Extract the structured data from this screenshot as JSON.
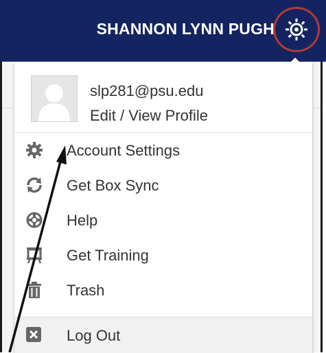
{
  "header": {
    "user_name": "SHANNON LYNN PUGH",
    "bg_color": "#142460",
    "gear_icon": "gear-icon"
  },
  "profile": {
    "email": "slp281@psu.edu",
    "edit_label": "Edit / View Profile",
    "avatar_icon": "person-silhouette-icon"
  },
  "menu": {
    "items": [
      {
        "label": "Account Settings",
        "icon": "gear-icon"
      },
      {
        "label": "Get Box Sync",
        "icon": "sync-icon"
      },
      {
        "label": "Help",
        "icon": "lifebuoy-icon"
      },
      {
        "label": "Get Training",
        "icon": "presentation-icon"
      },
      {
        "label": "Trash",
        "icon": "trash-icon"
      }
    ],
    "logout": {
      "label": "Log Out",
      "icon": "close-box-icon"
    }
  },
  "annotations": {
    "highlight_color": "#b3393a",
    "arrow_color": "#111111"
  }
}
